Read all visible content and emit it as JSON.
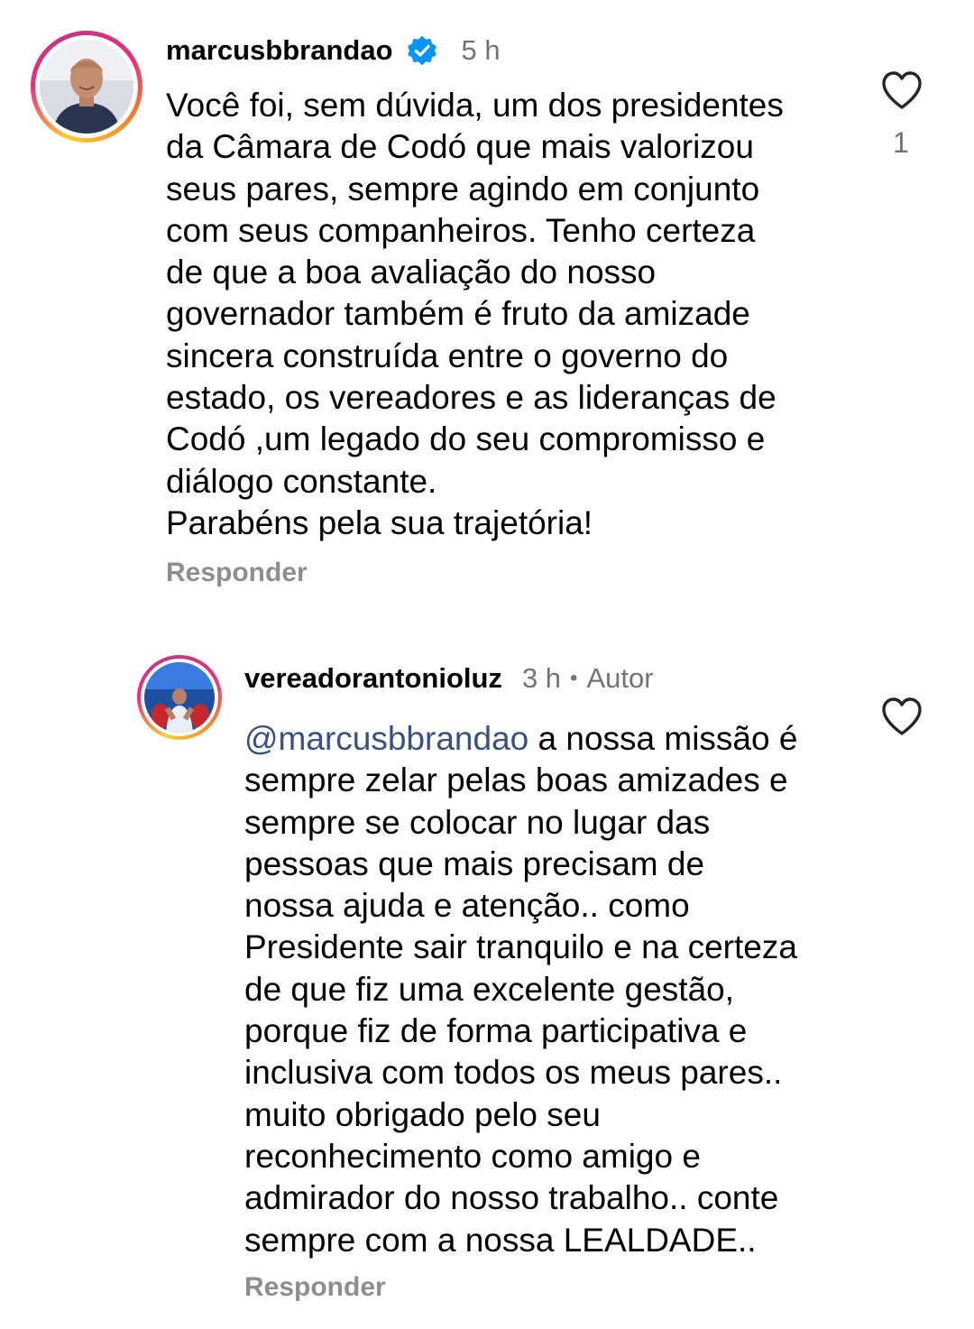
{
  "comments": [
    {
      "username": "marcusbbrandao",
      "time": "5 h",
      "verified": true,
      "text": "Você foi, sem dúvida, um dos presidentes\nda Câmara de Codó que mais valorizou\nseus pares, sempre agindo em conjunto\ncom seus companheiros. Tenho certeza\nde que a boa avaliação do nosso\ngovernador também é fruto da amizade\nsincera construída entre o governo do\nestado, os vereadores e as lideranças de\nCodó ,um legado do seu compromisso e\ndiálogo constante.\nParabéns pela sua trajetória!",
      "reply_label": "Responder",
      "like_count": "1",
      "icon": "heart-outline-icon"
    },
    {
      "username": "vereadorantonioluz",
      "time": "3 h",
      "author_label": "Autor",
      "mention": "@marcusbbrandao",
      "text": " a nossa missão é\nsempre zelar pelas boas amizades e\nsempre se colocar no lugar das\npessoas que mais precisam de\nnossa ajuda e atenção.. como\nPresidente sair tranquilo e na certeza\nde que fiz uma excelente gestão,\nporque fiz de forma participativa e\ninclusiva com todos os meus pares..\nmuito obrigado pelo seu\nreconhecimento como amigo e\nadmirador do nosso trabalho.. conte\nsempre com a nossa LEALDADE..",
      "reply_label": "Responder",
      "icon": "heart-outline-icon"
    }
  ],
  "colors": {
    "verified_badge": "#0095f6",
    "mention": "#385185",
    "secondary_text": "#737373"
  }
}
